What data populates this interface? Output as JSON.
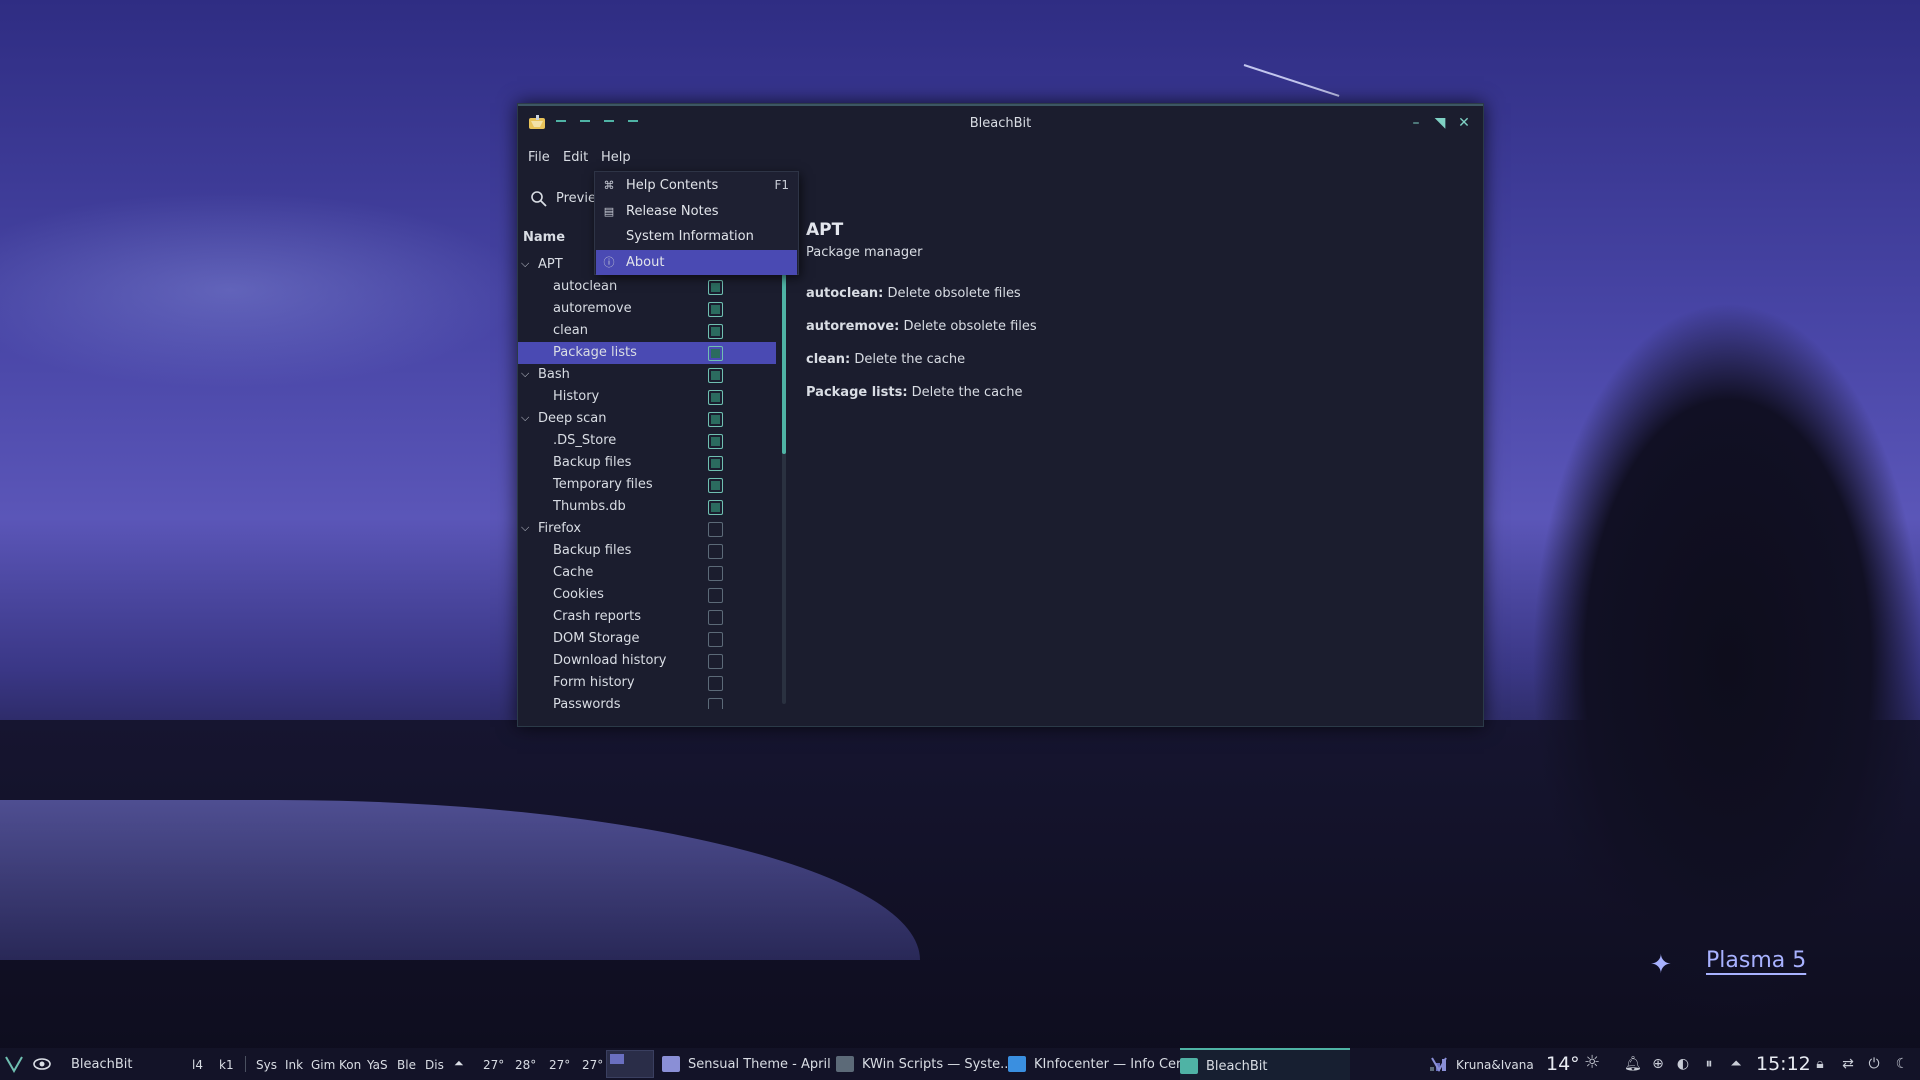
{
  "window": {
    "title": "BleachBit",
    "icon": "bleachbit-icon",
    "controls": [
      "minimize-icon",
      "maximize-icon",
      "close-icon"
    ]
  },
  "menubar": {
    "file": "File",
    "edit": "Edit",
    "help": "Help"
  },
  "help_menu": {
    "items": [
      {
        "label": "Help Contents",
        "shortcut": "F1",
        "icon": "help-contents-icon"
      },
      {
        "label": "Release Notes",
        "shortcut": "",
        "icon": "release-notes-icon"
      },
      {
        "label": "System Information",
        "shortcut": "",
        "icon": ""
      },
      {
        "label": "About",
        "shortcut": "",
        "icon": "info-icon"
      }
    ],
    "active_index": 3
  },
  "toolbar": {
    "preview_label": "Previe"
  },
  "tree": {
    "header": "Name",
    "rows": [
      {
        "label": "APT",
        "level": 0,
        "checked": null
      },
      {
        "label": "autoclean",
        "level": 1,
        "checked": true
      },
      {
        "label": "autoremove",
        "level": 1,
        "checked": true
      },
      {
        "label": "clean",
        "level": 1,
        "checked": true
      },
      {
        "label": "Package lists",
        "level": 1,
        "checked": true,
        "selected": true
      },
      {
        "label": "Bash",
        "level": 0,
        "checked": true
      },
      {
        "label": "History",
        "level": 1,
        "checked": true
      },
      {
        "label": "Deep scan",
        "level": 0,
        "checked": true
      },
      {
        "label": ".DS_Store",
        "level": 1,
        "checked": true
      },
      {
        "label": "Backup files",
        "level": 1,
        "checked": true
      },
      {
        "label": "Temporary files",
        "level": 1,
        "checked": true
      },
      {
        "label": "Thumbs.db",
        "level": 1,
        "checked": true
      },
      {
        "label": "Firefox",
        "level": 0,
        "checked": false
      },
      {
        "label": "Backup files",
        "level": 1,
        "checked": false
      },
      {
        "label": "Cache",
        "level": 1,
        "checked": false
      },
      {
        "label": "Cookies",
        "level": 1,
        "checked": false
      },
      {
        "label": "Crash reports",
        "level": 1,
        "checked": false
      },
      {
        "label": "DOM Storage",
        "level": 1,
        "checked": false
      },
      {
        "label": "Download history",
        "level": 1,
        "checked": false
      },
      {
        "label": "Form history",
        "level": 1,
        "checked": false
      },
      {
        "label": "Passwords",
        "level": 1,
        "checked": false
      }
    ]
  },
  "detail": {
    "title": "APT",
    "subtitle": "Package manager",
    "lines": [
      {
        "name": "autoclean:",
        "desc": " Delete obsolete files"
      },
      {
        "name": "autoremove:",
        "desc": " Delete obsolete files"
      },
      {
        "name": "clean:",
        "desc": " Delete the cache"
      },
      {
        "name": "Package lists:",
        "desc": " Delete the cache"
      }
    ]
  },
  "desktop": {
    "branding": "Plasma 5"
  },
  "taskbar": {
    "active_window_label": "BleachBit",
    "pager": [
      "l4",
      "k1"
    ],
    "launchers": [
      "Sys",
      "Ink",
      "Gim",
      "Kon",
      "YaS",
      "Ble",
      "Dis"
    ],
    "temps": [
      "27°",
      "28°",
      "27°",
      "27°"
    ],
    "tasks": [
      {
        "label": "Sensual Theme - April ...",
        "icon_color": "#8a8fd6"
      },
      {
        "label": "KWin Scripts — Syste...",
        "icon_color": "#5c6a78"
      },
      {
        "label": "KInfocenter — Info Cen...",
        "icon_color": "#3a8fe0"
      },
      {
        "label": "BleachBit",
        "icon_color": "#4fb3a5",
        "current": true
      }
    ],
    "user": "Kruna&Ivana",
    "weather_temp": "14°",
    "clock": "15:12"
  },
  "colors": {
    "accent": "#4fb3a5",
    "selection": "#4a4ab3",
    "window_bg": "#1b1d2e"
  }
}
